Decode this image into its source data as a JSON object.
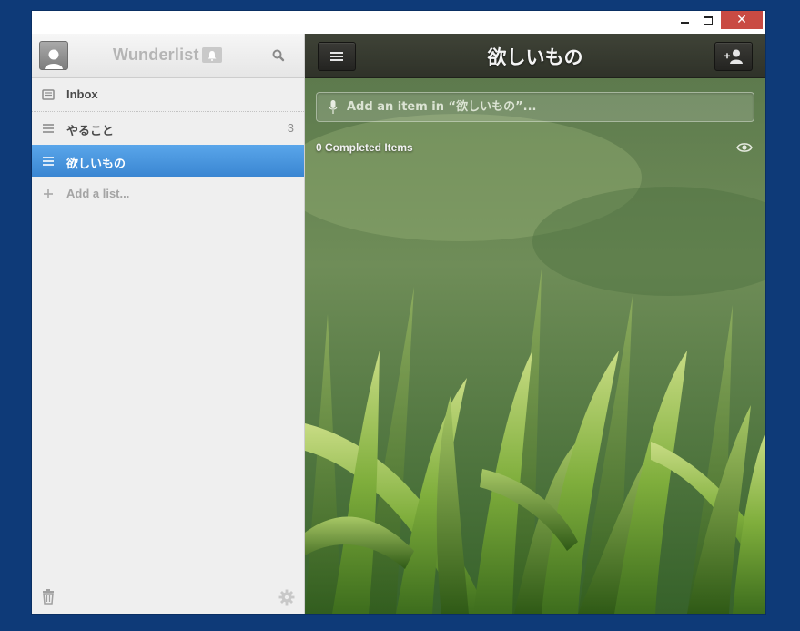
{
  "window": {
    "controls": {
      "minimize": "minimize",
      "maximize": "maximize",
      "close": "✕"
    }
  },
  "sidebar": {
    "brand": "Wunderlist",
    "lists": [
      {
        "label": "Inbox",
        "icon": "inbox-icon",
        "count": ""
      },
      {
        "label": "やること",
        "icon": "list-icon",
        "count": "3"
      },
      {
        "label": "欲しいもの",
        "icon": "list-icon",
        "count": "",
        "selected": true
      }
    ],
    "add_list_label": "Add a list..."
  },
  "main": {
    "title": "欲しいもの",
    "add_item_placeholder": "Add an item in “欲しいもの”...",
    "completed_label": "0 Completed Items"
  },
  "colors": {
    "desktop": "#0e3a78",
    "selected_list": "#3f8ad6",
    "close_button": "#c94b43"
  }
}
